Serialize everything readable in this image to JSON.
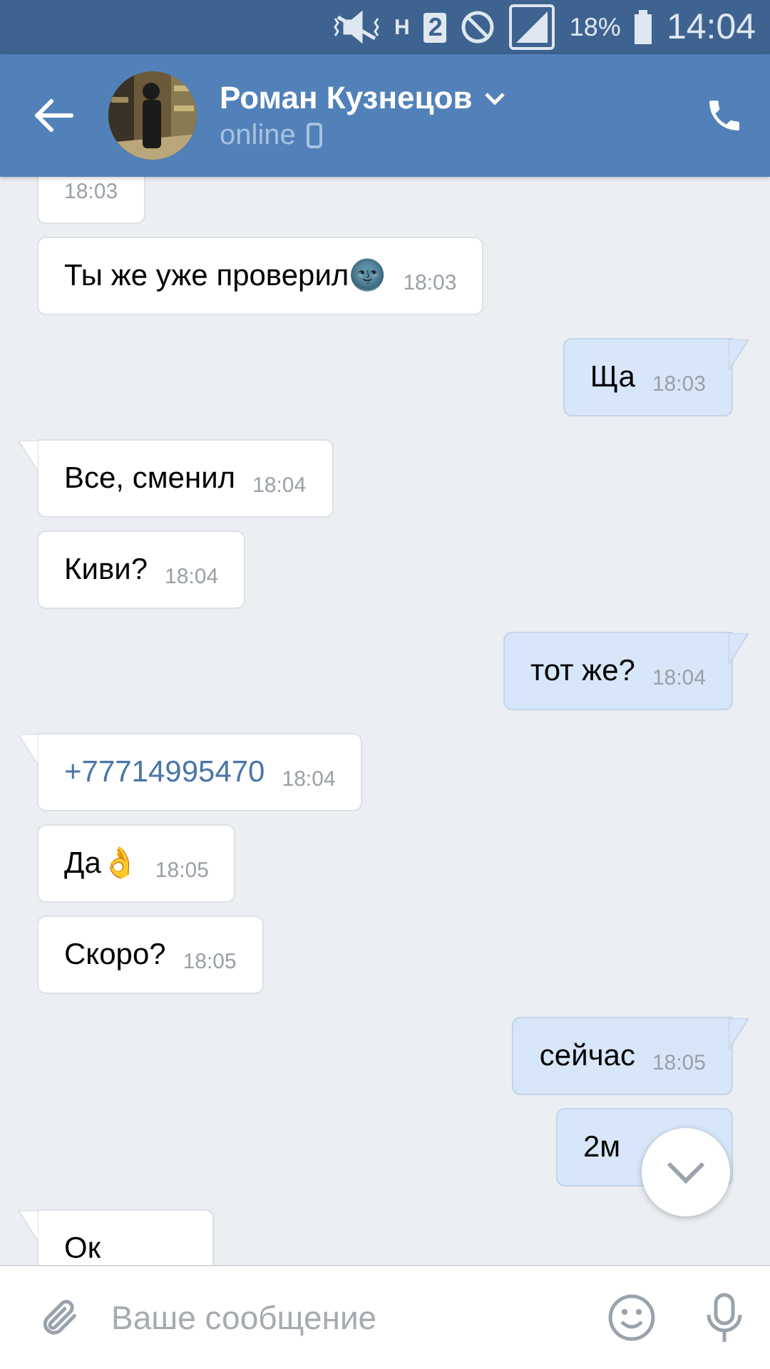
{
  "status_bar": {
    "battery": "18%",
    "time": "14:04",
    "network": "H",
    "sim": "2"
  },
  "header": {
    "name": "Роман Кузнецов",
    "presence": "online"
  },
  "messages": [
    {
      "outgoing": false,
      "time": "18:03"
    },
    {
      "outgoing": false,
      "tail": false,
      "kind": "text",
      "text": "Ты же уже проверил🌚",
      "time": "18:03"
    },
    {
      "outgoing": true,
      "tail": true,
      "kind": "text",
      "text": "Ща",
      "time": "18:03"
    },
    {
      "outgoing": false,
      "tail": true,
      "kind": "text",
      "text": "Все, сменил",
      "time": "18:04"
    },
    {
      "outgoing": false,
      "tail": false,
      "kind": "text",
      "text": "Киви?",
      "time": "18:04"
    },
    {
      "outgoing": true,
      "tail": true,
      "kind": "text",
      "text": "тот же?",
      "time": "18:04"
    },
    {
      "outgoing": false,
      "tail": true,
      "kind": "link",
      "text": "+77714995470",
      "time": "18:04"
    },
    {
      "outgoing": false,
      "tail": false,
      "kind": "text",
      "text": "Да👌",
      "time": "18:05"
    },
    {
      "outgoing": false,
      "tail": false,
      "kind": "text",
      "text": "Скоро?",
      "time": "18:05"
    },
    {
      "outgoing": true,
      "tail": true,
      "kind": "text",
      "text": "сейчас",
      "time": "18:05"
    },
    {
      "outgoing": true,
      "tail": false,
      "kind": "text",
      "text": "2м"
    },
    {
      "outgoing": false,
      "tail": true,
      "kind": "text",
      "text": "Ок"
    }
  ],
  "composer": {
    "placeholder": "Ваше сообщение"
  }
}
